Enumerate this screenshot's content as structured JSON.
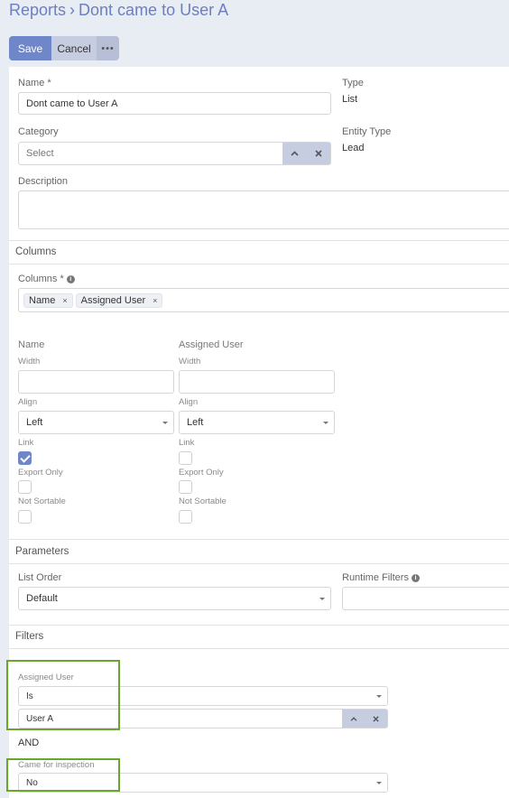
{
  "breadcrumb": {
    "root": "Reports",
    "separator": "›",
    "current": "Dont came to User A"
  },
  "toolbar": {
    "save_label": "Save",
    "cancel_label": "Cancel",
    "more_label": "•••"
  },
  "overview": {
    "name_label": "Name *",
    "name_value": "Dont came to User A",
    "category_label": "Category",
    "category_placeholder": "Select",
    "description_label": "Description",
    "type_label": "Type",
    "type_value": "List",
    "entity_type_label": "Entity Type",
    "entity_type_value": "Lead"
  },
  "columns_section": {
    "title": "Columns",
    "columns_label": "Columns *",
    "chips": [
      "Name",
      "Assigned User"
    ],
    "chip_remove": "×",
    "items": [
      {
        "title": "Name",
        "width_label": "Width",
        "align_label": "Align",
        "align_value": "Left",
        "link_label": "Link",
        "link_checked": true,
        "export_only_label": "Export Only",
        "not_sortable_label": "Not Sortable"
      },
      {
        "title": "Assigned User",
        "width_label": "Width",
        "align_label": "Align",
        "align_value": "Left",
        "link_label": "Link",
        "link_checked": false,
        "export_only_label": "Export Only",
        "not_sortable_label": "Not Sortable"
      }
    ]
  },
  "parameters_section": {
    "title": "Parameters",
    "list_order_label": "List Order",
    "list_order_value": "Default",
    "runtime_filters_label": "Runtime Filters"
  },
  "filters_section": {
    "title": "Filters",
    "filter1_label": "Assigned User",
    "filter1_operator": "Is",
    "filter1_value": "User A",
    "and_label": "AND",
    "filter2_label": "Came for inspection",
    "filter2_value": "No"
  },
  "colors": {
    "accent": "#6f87c9",
    "highlight_box": "#6aa52e"
  },
  "icons": {
    "info": "info-icon",
    "chevron_up": "chevron-up-icon",
    "clear": "close-icon",
    "caret": "caret-down-icon"
  }
}
